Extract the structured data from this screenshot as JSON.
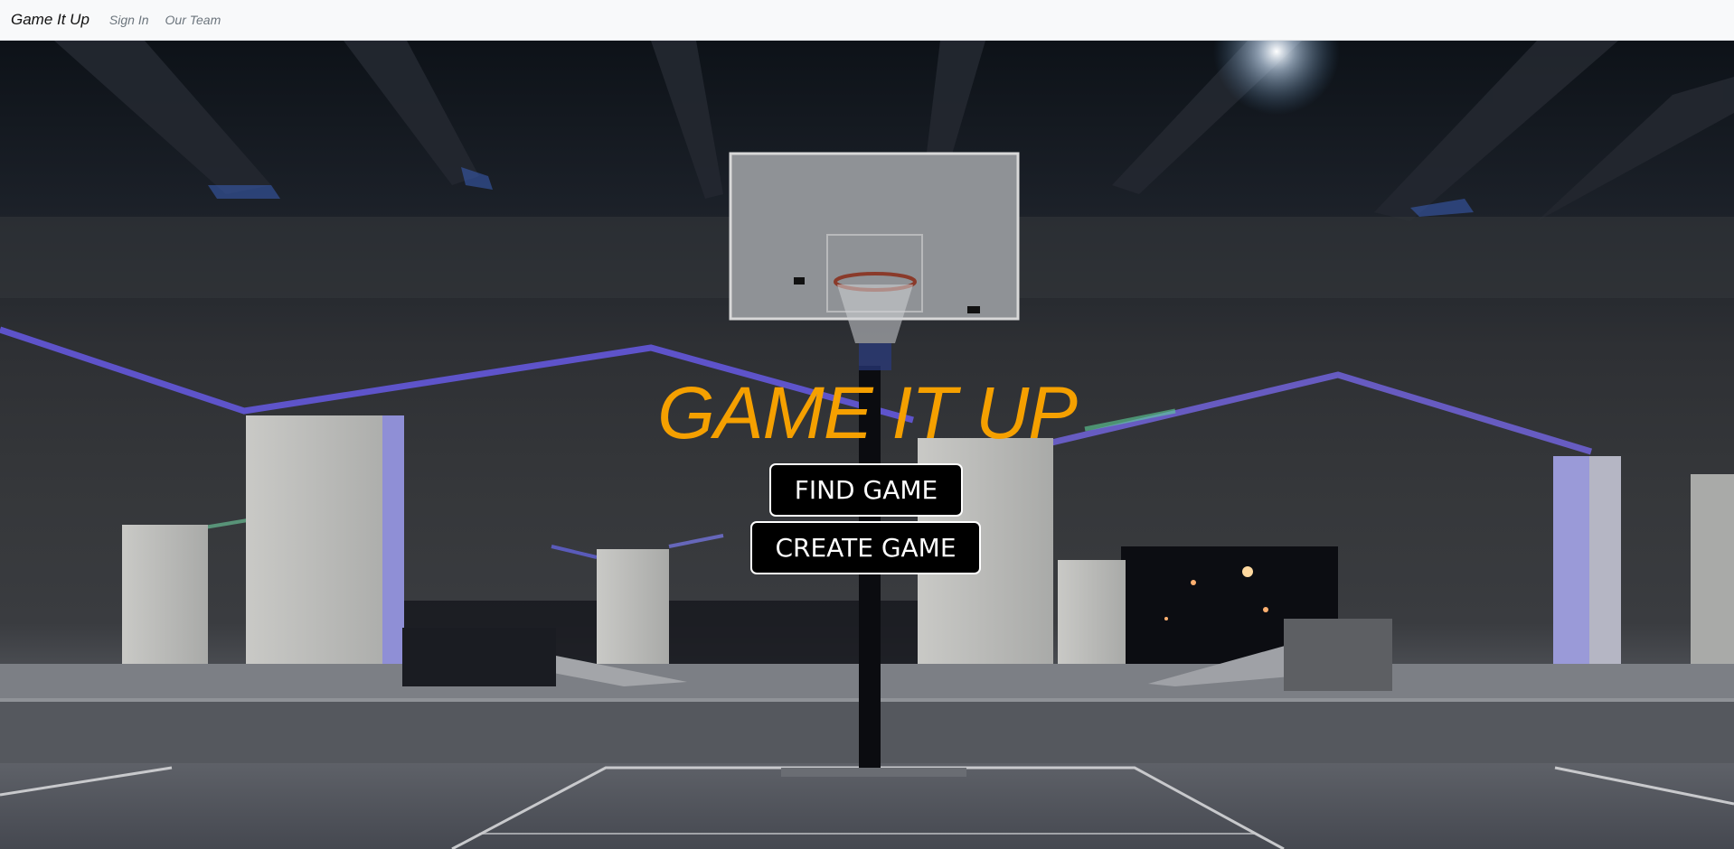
{
  "navbar": {
    "brand": "Game It Up",
    "links": [
      "Sign In",
      "Our Team"
    ]
  },
  "hero": {
    "title": "GAME IT UP",
    "find_label": "FIND GAME",
    "create_label": "CREATE GAME",
    "title_color": "#f5a000",
    "background_image": "night-basketball-court-under-overpass"
  }
}
